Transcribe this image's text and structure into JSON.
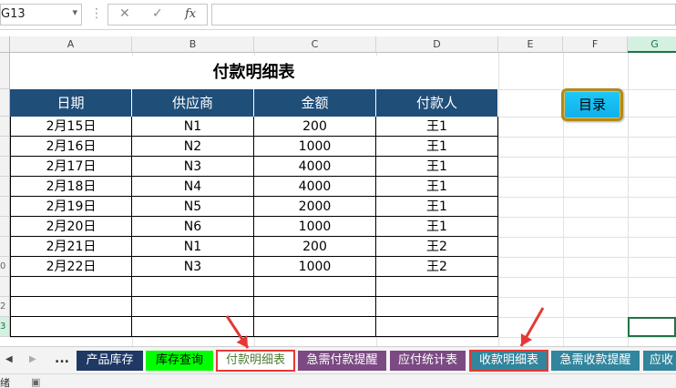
{
  "formula_bar": {
    "name_box": "G13",
    "cancel": "✕",
    "enter": "✓",
    "fx": "fx",
    "formula": ""
  },
  "columns": [
    "A",
    "B",
    "C",
    "D",
    "E",
    "F",
    "G"
  ],
  "selected_column": "G",
  "row_numbers": [
    "",
    "",
    "",
    "",
    "",
    "",
    "",
    "",
    "",
    "0",
    "",
    "2",
    "3"
  ],
  "sheet": {
    "title": "付款明细表",
    "headers": [
      "日期",
      "供应商",
      "金额",
      "付款人"
    ],
    "rows": [
      [
        "2月15日",
        "N1",
        "200",
        "王1"
      ],
      [
        "2月16日",
        "N2",
        "1000",
        "王1"
      ],
      [
        "2月17日",
        "N3",
        "4000",
        "王1"
      ],
      [
        "2月18日",
        "N4",
        "4000",
        "王1"
      ],
      [
        "2月19日",
        "N5",
        "2000",
        "王1"
      ],
      [
        "2月20日",
        "N6",
        "1000",
        "王1"
      ],
      [
        "2月21日",
        "N1",
        "200",
        "王2"
      ],
      [
        "2月22日",
        "N3",
        "1000",
        "王2"
      ],
      [
        "",
        "",
        "",
        ""
      ],
      [
        "",
        "",
        "",
        ""
      ],
      [
        "",
        "",
        "",
        ""
      ]
    ],
    "header_color": "#1f4e79"
  },
  "menu_button": {
    "label": "目录",
    "color": "#1ec8f8"
  },
  "tabs": [
    {
      "label": "产品库存",
      "color": "#1f3864",
      "text_color": "#ffffff",
      "active": false,
      "boxed": false
    },
    {
      "label": "库存查询",
      "color": "#00ff00",
      "text_color": "#000000",
      "active": false,
      "boxed": false
    },
    {
      "label": "付款明细表",
      "color": "#ffffff",
      "text_color": "#4d7d32",
      "active": true,
      "boxed": true
    },
    {
      "label": "急需付款提醒",
      "color": "#7b4a83",
      "text_color": "#ffffff",
      "active": false,
      "boxed": false
    },
    {
      "label": "应付统计表",
      "color": "#7b4a83",
      "text_color": "#ffffff",
      "active": false,
      "boxed": false
    },
    {
      "label": "收款明细表",
      "color": "#31859c",
      "text_color": "#ffffff",
      "active": false,
      "boxed": true
    },
    {
      "label": "急需收款提醒",
      "color": "#31859c",
      "text_color": "#ffffff",
      "active": false,
      "boxed": false
    },
    {
      "label": "应收",
      "color": "#31859c",
      "text_color": "#ffffff",
      "active": false,
      "boxed": false
    }
  ],
  "tab_nav": {
    "prev": "◀",
    "next": "▶",
    "more": "..."
  },
  "status_bar": {
    "text": "绪",
    "icon": "macro-record-icon"
  },
  "accent_color": "#217346",
  "annotation_color": "#e53935"
}
